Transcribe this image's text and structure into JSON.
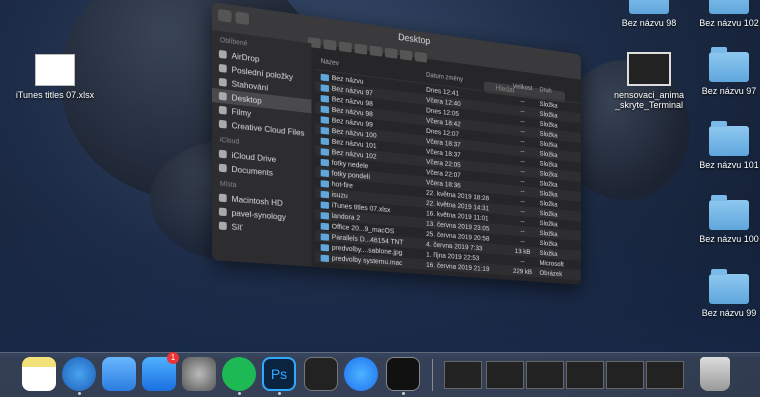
{
  "finder": {
    "title": "Desktop",
    "search_placeholder": "Hledat",
    "sidebar": {
      "sections": [
        {
          "header": "Oblíbené",
          "items": [
            "AirDrop",
            "Poslední položky",
            "Stahování",
            "Desktop",
            "Filmy",
            "Creative Cloud Files"
          ]
        },
        {
          "header": "iCloud",
          "items": [
            "iCloud Drive",
            "Documents"
          ]
        },
        {
          "header": "Místa",
          "items": [
            "Macintosh HD",
            "pavel-synology",
            "Síť"
          ]
        }
      ],
      "selected": "Desktop"
    },
    "columns": [
      "Název",
      "Datum změny",
      "Velikost",
      "Druh"
    ],
    "rows": [
      {
        "name": "Bez názvu",
        "date": "Dnes 12:41",
        "size": "--",
        "kind": "Složka"
      },
      {
        "name": "Bez názvu 97",
        "date": "Včera 12:40",
        "size": "--",
        "kind": "Složka"
      },
      {
        "name": "Bez názvu 98",
        "date": "Dnes 12:05",
        "size": "--",
        "kind": "Složka"
      },
      {
        "name": "Bez názvu 98",
        "date": "Včera 18:42",
        "size": "--",
        "kind": "Složka"
      },
      {
        "name": "Bez názvu 99",
        "date": "Dnes 12:07",
        "size": "--",
        "kind": "Složka"
      },
      {
        "name": "Bez názvu 100",
        "date": "Včera 18:37",
        "size": "--",
        "kind": "Složka"
      },
      {
        "name": "Bez názvu 101",
        "date": "Včera 18:37",
        "size": "--",
        "kind": "Složka"
      },
      {
        "name": "Bez názvu 102",
        "date": "Včera 22:05",
        "size": "--",
        "kind": "Složka"
      },
      {
        "name": "fotky nedele",
        "date": "Včera 22:07",
        "size": "--",
        "kind": "Složka"
      },
      {
        "name": "fotky pondeli",
        "date": "Včera 18:36",
        "size": "--",
        "kind": "Složka"
      },
      {
        "name": "hot-fire",
        "date": "22. května 2019 18:28",
        "size": "--",
        "kind": "Složka"
      },
      {
        "name": "isuzu",
        "date": "22. května 2019 14:31",
        "size": "--",
        "kind": "Složka"
      },
      {
        "name": "iTunes titles 07.xlsx",
        "date": "16. května 2019 11:01",
        "size": "--",
        "kind": "Složka"
      },
      {
        "name": "landora 2",
        "date": "13. června 2019 23:05",
        "size": "--",
        "kind": "Složka"
      },
      {
        "name": "Office 20...9_macOS",
        "date": "25. června 2019 20:58",
        "size": "--",
        "kind": "Složka"
      },
      {
        "name": "Parallels D...46154 TNT",
        "date": "4. června 2019 7:33",
        "size": "13 kB",
        "kind": "Složka"
      },
      {
        "name": "predvolby....sablone.jpg",
        "date": "1. října 2019 22:53",
        "size": "--",
        "kind": "Microsoft"
      },
      {
        "name": "predvolby systemu.mac",
        "date": "16. června 2019 21:19",
        "size": "229 kB",
        "kind": "Obrázek"
      }
    ]
  },
  "desktop": {
    "icons": [
      {
        "label": "iTunes titles 07.xlsx",
        "type": "file"
      },
      {
        "label": "Bez názvu 98",
        "type": "folder"
      },
      {
        "label": "Bez názvu 102",
        "type": "folder"
      },
      {
        "label": "nensovaci_anima _skryte_Terminal",
        "type": "terminal"
      },
      {
        "label": "Bez názvu 97",
        "type": "folder"
      },
      {
        "label": "Bez názvu 101",
        "type": "folder"
      },
      {
        "label": "Bez názvu 100",
        "type": "folder"
      },
      {
        "label": "Bez názvu 99",
        "type": "folder"
      }
    ]
  },
  "dock": {
    "apps": [
      "Notes",
      "Safari",
      "Messages",
      "App Store",
      "System Preferences",
      "Spotify",
      "Photoshop",
      "Activity Monitor",
      "Messenger",
      "Terminal"
    ],
    "appstore_badge": "1",
    "trash": "Trash"
  }
}
